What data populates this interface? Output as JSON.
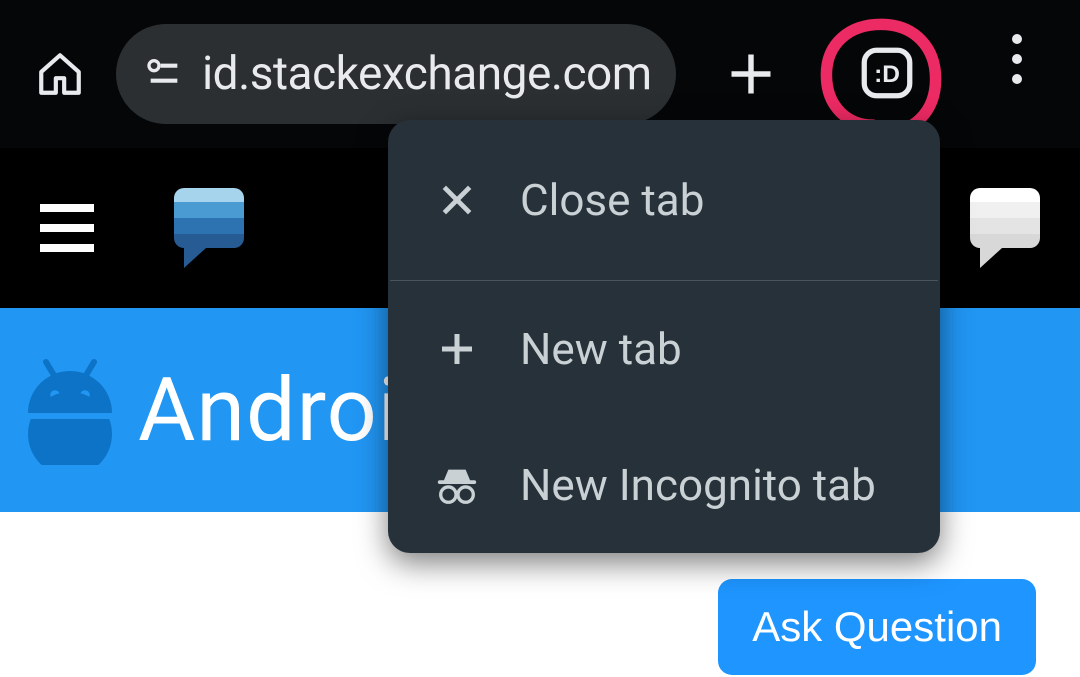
{
  "chrome": {
    "url_visible": "id.stackexchange.com",
    "tab_count_glyph": ":D"
  },
  "site": {
    "banner_title": "Android",
    "ask_button": "Ask Question"
  },
  "popup": {
    "close_tab": "Close tab",
    "new_tab": "New tab",
    "new_incognito": "New Incognito tab"
  }
}
